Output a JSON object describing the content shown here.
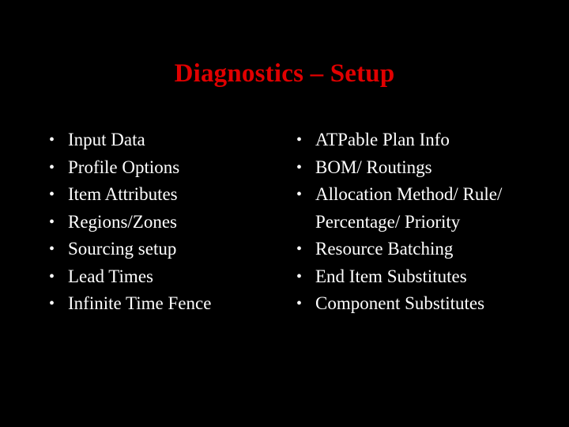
{
  "slide": {
    "background_color": "#000000",
    "title": "Diagnostics – Setup",
    "title_color": "#e00000",
    "body_text_color": "#ffffff",
    "bullet_glyph": "•"
  },
  "columns": {
    "left": {
      "items": [
        {
          "label": "Input Data"
        },
        {
          "label": "Profile Options"
        },
        {
          "label": "Item Attributes"
        },
        {
          "label": "Regions/Zones"
        },
        {
          "label": "Sourcing setup"
        },
        {
          "label": "Lead Times"
        },
        {
          "label": "Infinite Time Fence"
        }
      ]
    },
    "right": {
      "items": [
        {
          "label": "ATPable Plan Info"
        },
        {
          "label": "BOM/ Routings"
        },
        {
          "label": "Allocation Method/ Rule/ Percentage/ Priority"
        },
        {
          "label": "Resource Batching"
        },
        {
          "label": "End Item Substitutes"
        },
        {
          "label": "Component Substitutes"
        }
      ]
    }
  }
}
